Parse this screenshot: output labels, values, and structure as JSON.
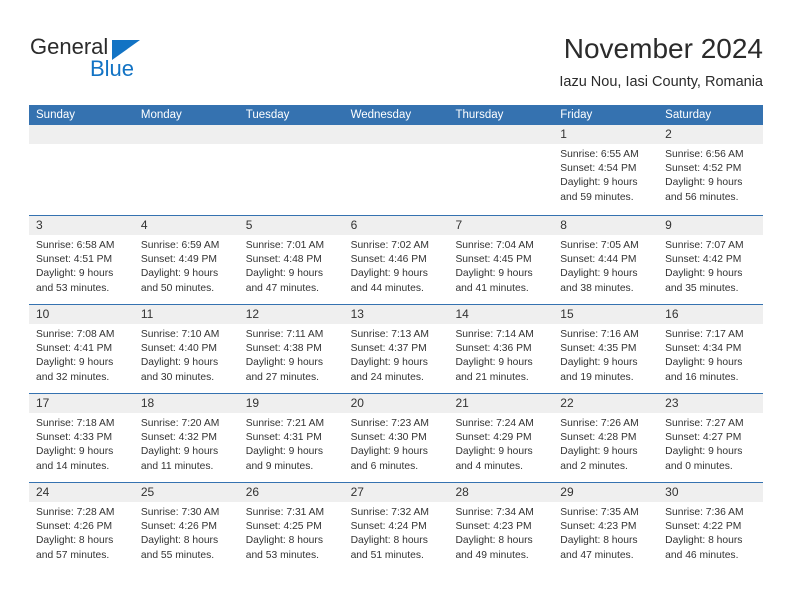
{
  "brand": {
    "name_part1": "General",
    "name_part2": "Blue",
    "triangle_icon": "blue-triangle-icon",
    "colors": {
      "blue": "#1273c4",
      "dark": "#2b2b2b"
    }
  },
  "header": {
    "title": "November 2024",
    "subtitle": "Iazu Nou, Iasi County, Romania"
  },
  "calendar": {
    "colors": {
      "header_bg": "#3572b0",
      "header_text": "#ffffff",
      "day_band_bg": "#efefef",
      "row_separator": "#3572b0",
      "body_text": "#333333"
    },
    "weekdays": [
      "Sunday",
      "Monday",
      "Tuesday",
      "Wednesday",
      "Thursday",
      "Friday",
      "Saturday"
    ],
    "weeks": [
      [
        {
          "day": "",
          "empty": true
        },
        {
          "day": "",
          "empty": true
        },
        {
          "day": "",
          "empty": true
        },
        {
          "day": "",
          "empty": true
        },
        {
          "day": "",
          "empty": true
        },
        {
          "day": "1",
          "sunrise": "Sunrise: 6:55 AM",
          "sunset": "Sunset: 4:54 PM",
          "daylight_line1": "Daylight: 9 hours",
          "daylight_line2": "and 59 minutes."
        },
        {
          "day": "2",
          "sunrise": "Sunrise: 6:56 AM",
          "sunset": "Sunset: 4:52 PM",
          "daylight_line1": "Daylight: 9 hours",
          "daylight_line2": "and 56 minutes."
        }
      ],
      [
        {
          "day": "3",
          "sunrise": "Sunrise: 6:58 AM",
          "sunset": "Sunset: 4:51 PM",
          "daylight_line1": "Daylight: 9 hours",
          "daylight_line2": "and 53 minutes."
        },
        {
          "day": "4",
          "sunrise": "Sunrise: 6:59 AM",
          "sunset": "Sunset: 4:49 PM",
          "daylight_line1": "Daylight: 9 hours",
          "daylight_line2": "and 50 minutes."
        },
        {
          "day": "5",
          "sunrise": "Sunrise: 7:01 AM",
          "sunset": "Sunset: 4:48 PM",
          "daylight_line1": "Daylight: 9 hours",
          "daylight_line2": "and 47 minutes."
        },
        {
          "day": "6",
          "sunrise": "Sunrise: 7:02 AM",
          "sunset": "Sunset: 4:46 PM",
          "daylight_line1": "Daylight: 9 hours",
          "daylight_line2": "and 44 minutes."
        },
        {
          "day": "7",
          "sunrise": "Sunrise: 7:04 AM",
          "sunset": "Sunset: 4:45 PM",
          "daylight_line1": "Daylight: 9 hours",
          "daylight_line2": "and 41 minutes."
        },
        {
          "day": "8",
          "sunrise": "Sunrise: 7:05 AM",
          "sunset": "Sunset: 4:44 PM",
          "daylight_line1": "Daylight: 9 hours",
          "daylight_line2": "and 38 minutes."
        },
        {
          "day": "9",
          "sunrise": "Sunrise: 7:07 AM",
          "sunset": "Sunset: 4:42 PM",
          "daylight_line1": "Daylight: 9 hours",
          "daylight_line2": "and 35 minutes."
        }
      ],
      [
        {
          "day": "10",
          "sunrise": "Sunrise: 7:08 AM",
          "sunset": "Sunset: 4:41 PM",
          "daylight_line1": "Daylight: 9 hours",
          "daylight_line2": "and 32 minutes."
        },
        {
          "day": "11",
          "sunrise": "Sunrise: 7:10 AM",
          "sunset": "Sunset: 4:40 PM",
          "daylight_line1": "Daylight: 9 hours",
          "daylight_line2": "and 30 minutes."
        },
        {
          "day": "12",
          "sunrise": "Sunrise: 7:11 AM",
          "sunset": "Sunset: 4:38 PM",
          "daylight_line1": "Daylight: 9 hours",
          "daylight_line2": "and 27 minutes."
        },
        {
          "day": "13",
          "sunrise": "Sunrise: 7:13 AM",
          "sunset": "Sunset: 4:37 PM",
          "daylight_line1": "Daylight: 9 hours",
          "daylight_line2": "and 24 minutes."
        },
        {
          "day": "14",
          "sunrise": "Sunrise: 7:14 AM",
          "sunset": "Sunset: 4:36 PM",
          "daylight_line1": "Daylight: 9 hours",
          "daylight_line2": "and 21 minutes."
        },
        {
          "day": "15",
          "sunrise": "Sunrise: 7:16 AM",
          "sunset": "Sunset: 4:35 PM",
          "daylight_line1": "Daylight: 9 hours",
          "daylight_line2": "and 19 minutes."
        },
        {
          "day": "16",
          "sunrise": "Sunrise: 7:17 AM",
          "sunset": "Sunset: 4:34 PM",
          "daylight_line1": "Daylight: 9 hours",
          "daylight_line2": "and 16 minutes."
        }
      ],
      [
        {
          "day": "17",
          "sunrise": "Sunrise: 7:18 AM",
          "sunset": "Sunset: 4:33 PM",
          "daylight_line1": "Daylight: 9 hours",
          "daylight_line2": "and 14 minutes."
        },
        {
          "day": "18",
          "sunrise": "Sunrise: 7:20 AM",
          "sunset": "Sunset: 4:32 PM",
          "daylight_line1": "Daylight: 9 hours",
          "daylight_line2": "and 11 minutes."
        },
        {
          "day": "19",
          "sunrise": "Sunrise: 7:21 AM",
          "sunset": "Sunset: 4:31 PM",
          "daylight_line1": "Daylight: 9 hours",
          "daylight_line2": "and 9 minutes."
        },
        {
          "day": "20",
          "sunrise": "Sunrise: 7:23 AM",
          "sunset": "Sunset: 4:30 PM",
          "daylight_line1": "Daylight: 9 hours",
          "daylight_line2": "and 6 minutes."
        },
        {
          "day": "21",
          "sunrise": "Sunrise: 7:24 AM",
          "sunset": "Sunset: 4:29 PM",
          "daylight_line1": "Daylight: 9 hours",
          "daylight_line2": "and 4 minutes."
        },
        {
          "day": "22",
          "sunrise": "Sunrise: 7:26 AM",
          "sunset": "Sunset: 4:28 PM",
          "daylight_line1": "Daylight: 9 hours",
          "daylight_line2": "and 2 minutes."
        },
        {
          "day": "23",
          "sunrise": "Sunrise: 7:27 AM",
          "sunset": "Sunset: 4:27 PM",
          "daylight_line1": "Daylight: 9 hours",
          "daylight_line2": "and 0 minutes."
        }
      ],
      [
        {
          "day": "24",
          "sunrise": "Sunrise: 7:28 AM",
          "sunset": "Sunset: 4:26 PM",
          "daylight_line1": "Daylight: 8 hours",
          "daylight_line2": "and 57 minutes."
        },
        {
          "day": "25",
          "sunrise": "Sunrise: 7:30 AM",
          "sunset": "Sunset: 4:26 PM",
          "daylight_line1": "Daylight: 8 hours",
          "daylight_line2": "and 55 minutes."
        },
        {
          "day": "26",
          "sunrise": "Sunrise: 7:31 AM",
          "sunset": "Sunset: 4:25 PM",
          "daylight_line1": "Daylight: 8 hours",
          "daylight_line2": "and 53 minutes."
        },
        {
          "day": "27",
          "sunrise": "Sunrise: 7:32 AM",
          "sunset": "Sunset: 4:24 PM",
          "daylight_line1": "Daylight: 8 hours",
          "daylight_line2": "and 51 minutes."
        },
        {
          "day": "28",
          "sunrise": "Sunrise: 7:34 AM",
          "sunset": "Sunset: 4:23 PM",
          "daylight_line1": "Daylight: 8 hours",
          "daylight_line2": "and 49 minutes."
        },
        {
          "day": "29",
          "sunrise": "Sunrise: 7:35 AM",
          "sunset": "Sunset: 4:23 PM",
          "daylight_line1": "Daylight: 8 hours",
          "daylight_line2": "and 47 minutes."
        },
        {
          "day": "30",
          "sunrise": "Sunrise: 7:36 AM",
          "sunset": "Sunset: 4:22 PM",
          "daylight_line1": "Daylight: 8 hours",
          "daylight_line2": "and 46 minutes."
        }
      ]
    ]
  }
}
